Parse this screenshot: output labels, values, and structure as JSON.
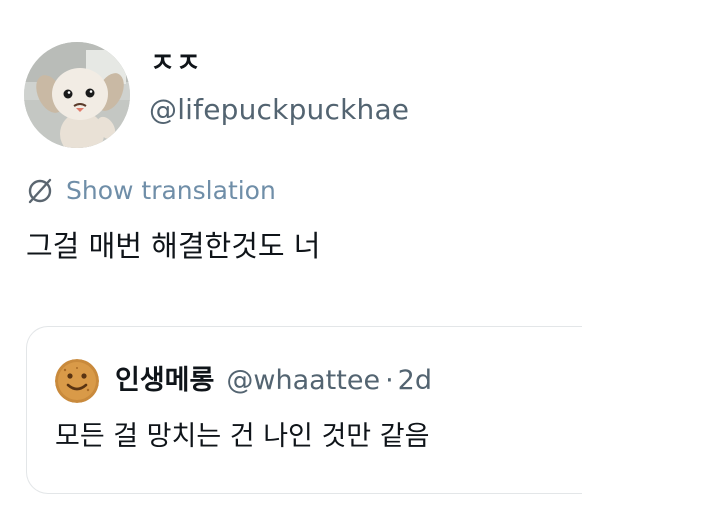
{
  "tweet": {
    "author": {
      "display_name": "ㅈㅈ",
      "handle": "@lifepuckpuckhae",
      "avatar_icon": "puppy-character-avatar"
    },
    "translate": {
      "icon": "globe-icon",
      "label": "Show translation",
      "color": "#6f8ea8"
    },
    "text": "그걸 매번 해결한것도 너"
  },
  "quote": {
    "avatar_icon": "smiling-cookie-avatar",
    "display_name": "인생메롱",
    "handle": "@whaattee",
    "separator": "·",
    "time": "2d",
    "text": "모든 걸 망치는 건 나인 것만 같음"
  },
  "colors": {
    "primary_text": "#0f1419",
    "secondary_text": "#536471",
    "border": "#e3e6e8"
  }
}
